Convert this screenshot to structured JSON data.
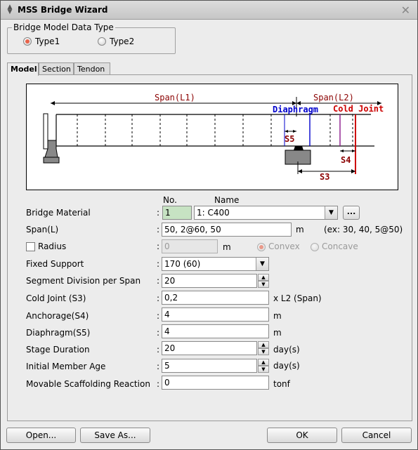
{
  "window": {
    "title": "MSS Bridge Wizard"
  },
  "data_type": {
    "legend": "Bridge Model Data Type",
    "options": [
      {
        "label": "Type1",
        "selected": true
      },
      {
        "label": "Type2",
        "selected": false
      }
    ]
  },
  "tabs": [
    {
      "label": "Model",
      "active": true
    },
    {
      "label": "Section",
      "active": false
    },
    {
      "label": "Tendon",
      "active": false
    }
  ],
  "diagram": {
    "span_l1": "Span(L1)",
    "span_l2": "Span(L2)",
    "diaphragm": "Diaphragm",
    "cold_joint": "Cold Joint",
    "s5": "S5",
    "s4": "S4",
    "s3": "S3",
    "colors": {
      "diaphragm": "#0000cc",
      "cold_joint": "#cc0000",
      "dim": "#8b0000"
    }
  },
  "form": {
    "col_no": "No.",
    "col_name": "Name",
    "material": {
      "label": "Bridge Material",
      "no": "1",
      "name": "1: C400"
    },
    "span": {
      "label": "Span(L)",
      "value": "50, 2@60, 50",
      "unit": "m",
      "example": "(ex: 30, 40, 5@50)"
    },
    "radius": {
      "label": "Radius",
      "value": "0",
      "unit": "m",
      "checked": false,
      "convex": "Convex",
      "concave": "Concave"
    },
    "fixed_support": {
      "label": "Fixed Support",
      "value": "170 (60)"
    },
    "segment_division": {
      "label": "Segment Division per Span",
      "value": "20"
    },
    "cold_joint": {
      "label": "Cold Joint (S3)",
      "value": "0,2",
      "unit": "x L2 (Span)"
    },
    "anchorage": {
      "label": "Anchorage(S4)",
      "value": "4",
      "unit": "m"
    },
    "diaphragm": {
      "label": "Diaphragm(S5)",
      "value": "4",
      "unit": "m"
    },
    "stage_duration": {
      "label": "Stage Duration",
      "value": "20",
      "unit": "day(s)"
    },
    "initial_age": {
      "label": "Initial Member Age",
      "value": "5",
      "unit": "day(s)"
    },
    "scaffolding_reaction": {
      "label": "Movable Scaffolding Reaction",
      "value": "0",
      "unit": "tonf"
    },
    "colon": ":",
    "ellipsis": "..."
  },
  "buttons": {
    "open": "Open...",
    "save_as": "Save As...",
    "ok": "OK",
    "cancel": "Cancel"
  },
  "icons": {
    "title": "app-icon",
    "close": "close-icon",
    "dropdown": "chevron-down-icon"
  }
}
